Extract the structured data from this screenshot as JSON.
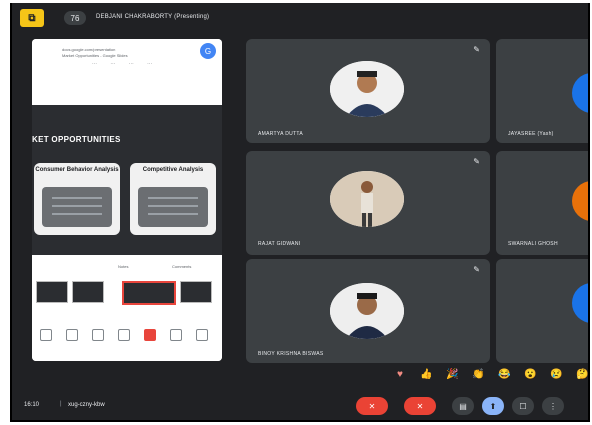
{
  "topbar": {
    "present_icon": "present-icon",
    "pin_label": "76",
    "presenter": "DEBJANI CHAKRABORTY (Presenting)"
  },
  "presentation": {
    "browser_line1": "docs.google.com/presentation",
    "browser_line2": "Market Opportunities - Google Slides",
    "brand_label": "G",
    "tools_label": "⋯ ⋯ ⋯ ⋯",
    "slide_title": "KET OPPORTUNITIES",
    "card1_title": "Consumer Behavior Analysis",
    "card2_title": "Competitive Analysis",
    "bottom_left": "Notes",
    "bottom_right": "Comments"
  },
  "participants": [
    {
      "name": "AMARTYA DUTTA"
    },
    {
      "name": "JAYASREE (Yash)"
    },
    {
      "name": "RAJAT GIDWANI"
    },
    {
      "name": "SWARNALI GHOSH"
    },
    {
      "name": "BINOY KRISHNA BISWAS"
    },
    {
      "name": ""
    }
  ],
  "pin_glyph": "✎",
  "reactions": [
    "♥",
    "👍",
    "🎉",
    "👏",
    "😂",
    "😮",
    "😢",
    "🤔"
  ],
  "meeting": {
    "time": "16:10",
    "separator": "|",
    "code": "xug-czny-kbw"
  },
  "controls": {
    "mic": "✕",
    "cam": "✕",
    "captions": "▤",
    "present": "⬆",
    "hand": "☐",
    "more": "⋮"
  },
  "colors": {
    "app_bg": "#202124",
    "tile_bg": "#3c4043",
    "accent_red": "#ea4335",
    "accent_blue": "#8ab4f8"
  }
}
